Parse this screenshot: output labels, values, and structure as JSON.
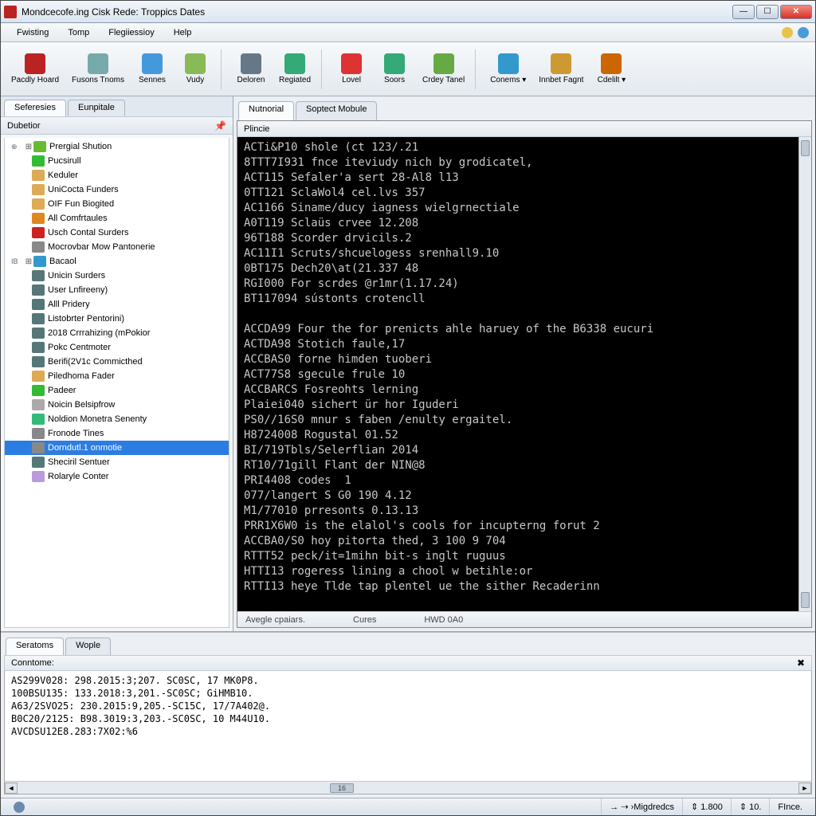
{
  "window": {
    "title": "Mondcecofe.ing Cisk Rede: Troppics Dates"
  },
  "menu": {
    "items": [
      "Fwisting",
      "Tomp",
      "Flegiiessioy",
      "Help"
    ]
  },
  "toolbar": {
    "buttons": [
      {
        "label": "Pacdly\nHoard",
        "color": "#b22"
      },
      {
        "label": "Fusons\nTnoms",
        "color": "#7aa"
      },
      {
        "label": "Sennes",
        "color": "#49d"
      },
      {
        "label": "Vudy",
        "color": "#8b5"
      },
      {
        "label": "Deloren",
        "color": "#678"
      },
      {
        "label": "Regiated",
        "color": "#3a7"
      },
      {
        "label": "Lovel",
        "color": "#d33"
      },
      {
        "label": "Soors",
        "color": "#3a7"
      },
      {
        "label": "Crdey\nTanel",
        "color": "#6a4"
      },
      {
        "label": "Conems\n▾",
        "color": "#39c"
      },
      {
        "label": "Innbet\nFagnt",
        "color": "#c93"
      },
      {
        "label": "Cdelilt\n▾",
        "color": "#c60"
      }
    ]
  },
  "left": {
    "tabs": [
      "Seferesies",
      "Eunpitale"
    ],
    "active_tab": 0,
    "header": "Dubetior",
    "tree": [
      {
        "t": "Prergial Shution",
        "c": "#6b3",
        "lvl": 0,
        "exp": "⊞"
      },
      {
        "t": "Pucsirull",
        "c": "#3b3",
        "lvl": 1,
        "exp": "•"
      },
      {
        "t": "Keduler",
        "c": "#da5",
        "lvl": 1
      },
      {
        "t": "UniCocta Funders",
        "c": "#da5",
        "lvl": 1
      },
      {
        "t": "OIF Fun Biogited",
        "c": "#da5",
        "lvl": 1
      },
      {
        "t": "All Comfrtaules",
        "c": "#d82",
        "lvl": 1
      },
      {
        "t": "Usch Contal Surders",
        "c": "#c22",
        "lvl": 1
      },
      {
        "t": "Mocrovbar Mow Pantonerie",
        "c": "#888",
        "lvl": 1
      },
      {
        "t": "Bacaol",
        "c": "#39c",
        "lvl": 0,
        "exp": "⊞"
      },
      {
        "t": "Unicin Surders",
        "c": "#577",
        "lvl": 1
      },
      {
        "t": "User Lnfireeny)",
        "c": "#577",
        "lvl": 1
      },
      {
        "t": "Alll Pridery",
        "c": "#577",
        "lvl": 1
      },
      {
        "t": "Listobrter Pentorini)",
        "c": "#577",
        "lvl": 1
      },
      {
        "t": "2018 Crrrahizing (mPokior",
        "c": "#577",
        "lvl": 1
      },
      {
        "t": "Pokc Centmoter",
        "c": "#577",
        "lvl": 1
      },
      {
        "t": "Berifi(2V1c Commicthed",
        "c": "#577",
        "lvl": 1
      },
      {
        "t": "Piledhoma Fader",
        "c": "#da5",
        "lvl": 1
      },
      {
        "t": "Padeer",
        "c": "#3b3",
        "lvl": 1
      },
      {
        "t": "Noicin Belsipfrow",
        "c": "#aaa",
        "lvl": 1
      },
      {
        "t": "Noldion Monetra Senenty",
        "c": "#3b7",
        "lvl": 1
      },
      {
        "t": "Fronode Tines",
        "c": "#888",
        "lvl": 1
      },
      {
        "t": "Dorndutl.1 onmotie",
        "c": "#888",
        "lvl": 1,
        "sel": true
      },
      {
        "t": "Sheciril Sentuer",
        "c": "#577",
        "lvl": 1
      },
      {
        "t": "Rolaryle Conter",
        "c": "#b9d",
        "lvl": 1
      }
    ]
  },
  "right": {
    "tabs": [
      "Nutnorial",
      "Soptect Mobule"
    ],
    "active_tab": 0,
    "header": "Plincie",
    "console_lines": [
      "ACTi&P10 shole (ct 123/.21",
      "8TTT7I931 fnce iteviudy nich by grodicatel,",
      "ACT115 Sefaler'a sert 28-Al8 l13",
      "0TT121 SclaWol4 cel.lvs 357",
      "AC1166 Siname/ducy iagness wielgrnectiale",
      "A0T119 Sclaüs crvee 12.208",
      "96T188 Scorder drvicils.2",
      "AC11I1 Scruts/shcuelogess srenhall9.10",
      "0BT175 Dech20\\at(21.337 48",
      "RGI000 For scrdes @r1mr(1.17.24)",
      "BT117094 sústonts crotencll",
      "",
      "ACCDA99 Four the for prenicts ahle haruey of the B6338 eucuri",
      "ACTDA98 Stotich faule,17",
      "ACCBAS0 forne himden tuoberi",
      "ACT77S8 sgecule frule 10",
      "ACCBARCS Fosreohts lerning",
      "Plaiei040 sichert ür hor Iguderi",
      "PS0//16S0 mnur s faben /enulty ergaitel.",
      "H8724008 Rogustal 01.52",
      "BI/719Tbls/Selerflian 2014",
      "RT10/71gill Flant der NIN@8",
      "PRI4408 codes  1",
      "077/langert S G0 190 4.12",
      "M1/77010 prresonts 0.13.13",
      "PRR1X6W0 is the elalol's cools for incupterng forut 2",
      "ACCBA0/S0 hoy pitorta thed, 3 100 9 704",
      "RTTT52 peck/it=1mihn bit-s inglt ruguus",
      "HTTI13 rogeress lining a chool w betihle:or",
      "RTTI13 heye Tlde tap plentel ue the sither Recaderinn"
    ],
    "status": [
      "Avegle cpaiars.",
      "Cures",
      "HWD 0A0"
    ]
  },
  "bottom": {
    "tabs": [
      "Seratoms",
      "Wople"
    ],
    "active_tab": 0,
    "header": "Conntome:",
    "lines": [
      "AS299V028: 298.2015:3;207. SC0SC, 17 MK0P8.",
      "100BSU135: 133.2018:3,201.-SC0SC; GiHMB10.",
      "A63/2SVO25: 230.2015:9,205.-SC15C, 17/7A402@.",
      "B0C20/2125: B98.3019:3,203.-SC0SC, 10 M44U10.",
      "AVCDSU12E8.283:7X02:%6"
    ],
    "hscroll_label": "16"
  },
  "status": {
    "cells": [
      "→ ⇢ ›Migdredcs",
      "⇕ 1.800",
      "⇕ 10.",
      "FInce."
    ]
  }
}
